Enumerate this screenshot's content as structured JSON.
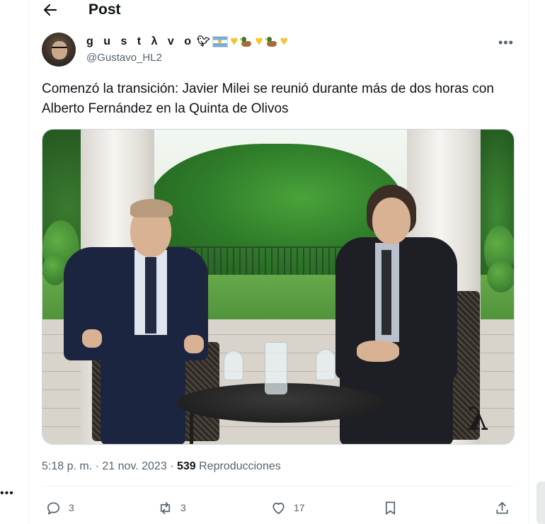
{
  "header": {
    "title": "Post"
  },
  "author": {
    "display_name": "g u s t λ v o",
    "handle": "@Gustavo_HL2"
  },
  "tweet": {
    "text": "Comenzó la transición: Javier Milei se reunió durante más de dos horas con Alberto Fernández en la Quinta de Olivos"
  },
  "meta": {
    "time": "5:18 p. m.",
    "separator": "·",
    "date": "21 nov. 2023",
    "views_count": "539",
    "views_label": "Reproducciones"
  },
  "actions": {
    "replies": "3",
    "reposts": "3",
    "likes": "17"
  },
  "colors": {
    "text": "#0f1419",
    "secondary": "#536471",
    "border": "#eff3f4"
  },
  "icons": [
    "back-arrow-icon",
    "bird-icon",
    "argentina-flag-icon",
    "heart-icon",
    "duck-icon",
    "more-icon",
    "reply-icon",
    "repost-icon",
    "like-icon",
    "bookmark-icon",
    "share-icon"
  ]
}
